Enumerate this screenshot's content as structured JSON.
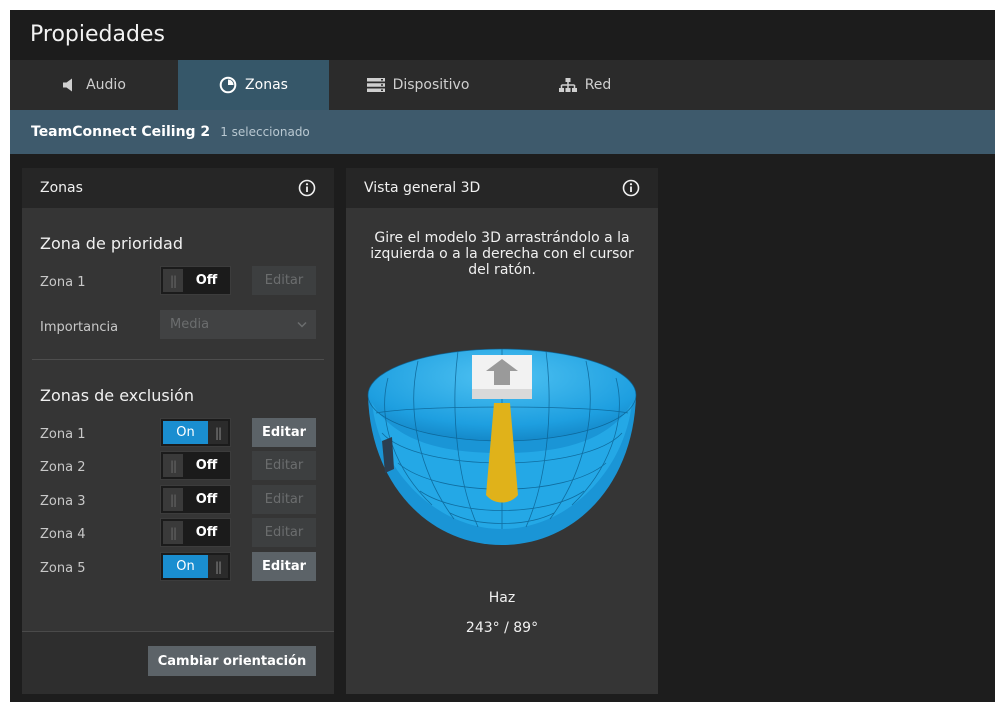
{
  "window": {
    "title": "Propiedades"
  },
  "tabs": [
    {
      "label": "Audio",
      "icon": "speaker-icon"
    },
    {
      "label": "Zonas",
      "icon": "zones-icon",
      "active": true
    },
    {
      "label": "Dispositivo",
      "icon": "device-icon"
    },
    {
      "label": "Red",
      "icon": "network-icon"
    }
  ],
  "device": {
    "name": "TeamConnect Ceiling 2",
    "selection": "1 seleccionado"
  },
  "zones_panel": {
    "title": "Zonas",
    "priority": {
      "title": "Zona de prioridad",
      "zone_label": "Zona 1",
      "toggle": "Off",
      "edit": "Editar",
      "importance_label": "Importancia",
      "importance_value": "Media"
    },
    "exclusion": {
      "title": "Zonas de exclusión",
      "zones": [
        {
          "label": "Zona 1",
          "state": "On",
          "edit": "Editar"
        },
        {
          "label": "Zona 2",
          "state": "Off",
          "edit": "Editar"
        },
        {
          "label": "Zona 3",
          "state": "Off",
          "edit": "Editar"
        },
        {
          "label": "Zona 4",
          "state": "Off",
          "edit": "Editar"
        },
        {
          "label": "Zona 5",
          "state": "On",
          "edit": "Editar"
        }
      ]
    },
    "change_orientation": "Cambiar orientación"
  },
  "overview_panel": {
    "title": "Vista general 3D",
    "instructions": "Gire el modelo 3D arrastrándolo a la izquierda o a la derecha con el cursor del ratón.",
    "beam_label": "Haz",
    "beam_value": "243° / 89°"
  },
  "colors": {
    "accent": "#1a8ed0",
    "device_bar": "#3e5a6c",
    "active_tab": "#365769",
    "dome": "#1fa3e2",
    "beam": "#e0b21a"
  }
}
